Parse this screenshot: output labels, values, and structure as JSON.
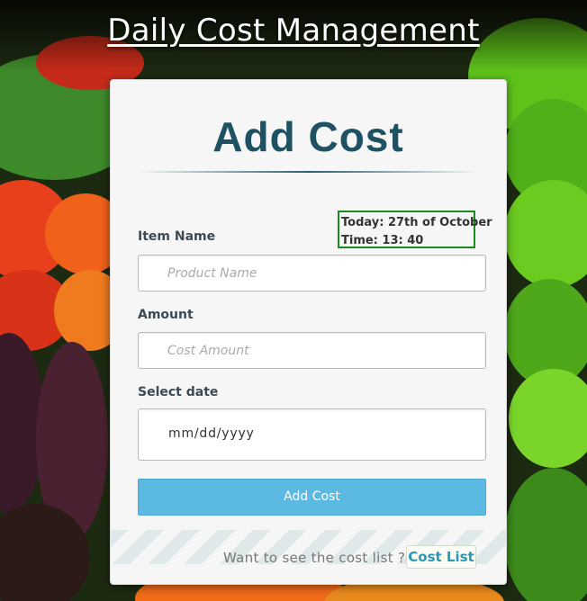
{
  "header": {
    "title": "Daily Cost Management"
  },
  "form": {
    "title": "Add Cost",
    "datetime": {
      "date": "Today: 27th of October",
      "time": "Time: 13: 40"
    },
    "item": {
      "label": "Item Name",
      "placeholder": "Product Name"
    },
    "amount": {
      "label": "Amount",
      "placeholder": "Cost Amount"
    },
    "date": {
      "label": "Select date",
      "value": "mm/dd/yyyy"
    },
    "submit_label": "Add Cost"
  },
  "footer": {
    "prompt": "Want to see the cost list ?",
    "link_label": "Cost List"
  },
  "colors": {
    "accent": "#5bb9e2",
    "title": "#1e5263",
    "highlight_border": "#1a8a1a",
    "link": "#2d97b4"
  }
}
